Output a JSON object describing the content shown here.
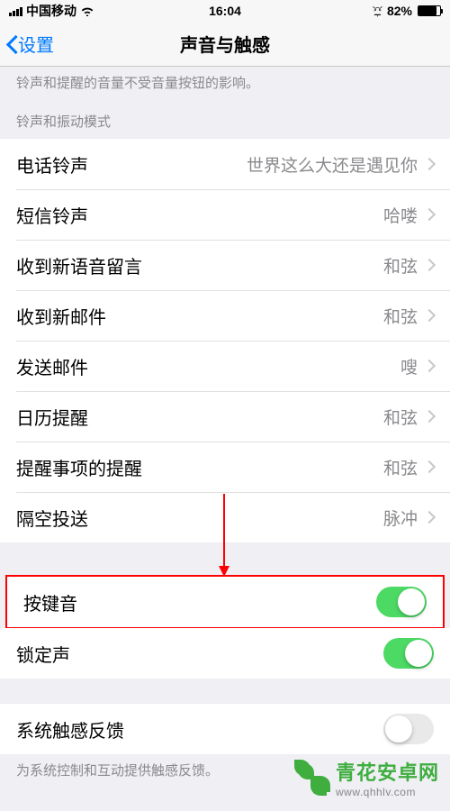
{
  "status": {
    "carrier": "中国移动",
    "time": "16:04",
    "battery_pct": "82%"
  },
  "nav": {
    "back_label": "设置",
    "title": "声音与触感"
  },
  "footers": {
    "ringer_note": "铃声和提醒的音量不受音量按钮的影响。",
    "haptic_note": "为系统控制和互动提供触感反馈。"
  },
  "headers": {
    "ringtone_pattern": "铃声和振动模式"
  },
  "rows": {
    "ringtone": {
      "label": "电话铃声",
      "value": "世界这么大还是遇见你"
    },
    "text_tone": {
      "label": "短信铃声",
      "value": "哈喽"
    },
    "voicemail": {
      "label": "收到新语音留言",
      "value": "和弦"
    },
    "new_mail": {
      "label": "收到新邮件",
      "value": "和弦"
    },
    "sent_mail": {
      "label": "发送邮件",
      "value": "嗖"
    },
    "calendar": {
      "label": "日历提醒",
      "value": "和弦"
    },
    "reminders": {
      "label": "提醒事项的提醒",
      "value": "和弦"
    },
    "airdrop": {
      "label": "隔空投送",
      "value": "脉冲"
    },
    "key_clicks": {
      "label": "按键音"
    },
    "lock_sound": {
      "label": "锁定声"
    },
    "haptics": {
      "label": "系统触感反馈"
    }
  },
  "watermark": {
    "title": "青花安卓网",
    "url": "www.qhhlv.com"
  }
}
